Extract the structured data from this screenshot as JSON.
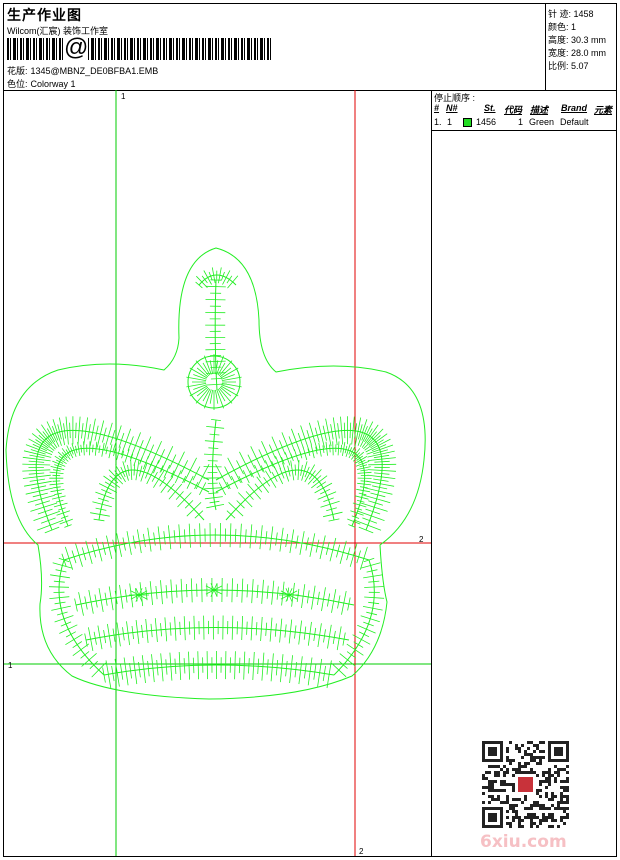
{
  "header": {
    "title": "生产作业图",
    "studio": "Wilcom(汇宸) 装饰工作室",
    "barcode_symbol": "@",
    "design_label": "花版:",
    "design_value": "1345@MBNZ_DE0BFBA1.EMB",
    "colorway_label": "色位:",
    "colorway_value": "Colorway 1"
  },
  "specs": [
    {
      "label": "针 迹:",
      "value": "1458"
    },
    {
      "label": "颜色:",
      "value": "1"
    },
    {
      "label": "高度:",
      "value": "30.3 mm"
    },
    {
      "label": "宽度:",
      "value": "28.0 mm"
    },
    {
      "label": "比例:",
      "value": "5.07"
    }
  ],
  "canvas": {
    "marker_1_top": "1",
    "marker_1_left": "1",
    "marker_2_right": "2",
    "marker_2_bottom": "2",
    "guide_color": "#00cc00",
    "cross_color": "#e00000",
    "stitch_color": "#22ee22"
  },
  "stop_sequence": {
    "title": "停止顺序 :",
    "columns": [
      "#",
      "N#",
      "St.",
      "代码",
      "描述",
      "Brand",
      "元素"
    ],
    "rows": [
      {
        "index": "1.",
        "needle": "1",
        "color": "#22dd22",
        "stitches": "1456",
        "code": "1",
        "description": "Green",
        "brand": "Default",
        "element": ""
      }
    ]
  },
  "watermark": {
    "text": "6xiu.com",
    "qr_label": "qr-code"
  }
}
